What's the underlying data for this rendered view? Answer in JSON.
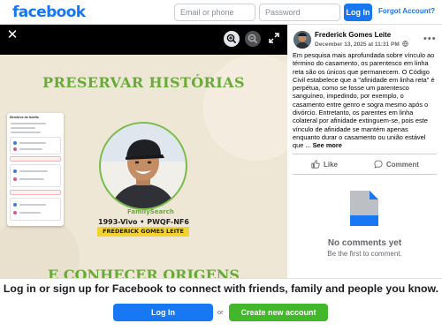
{
  "topbar": {
    "logo": "facebook",
    "email_placeholder": "Email or phone",
    "password_placeholder": "Password",
    "login_label": "Log In",
    "forgot_label": "Forgot Account?"
  },
  "viewer": {
    "close_icon": "close-icon",
    "zoom_in_icon": "zoom-in-icon",
    "zoom_out_icon": "zoom-out-icon",
    "expand_icon": "expand-icon",
    "photo": {
      "title": "PRESERVAR HISTÓRIAS",
      "logo_text": "FamilySearch",
      "person_id": "1993-Vivo • PWQF-NF6",
      "name_banner": "FREDERICK GOMES LEITE",
      "bottom_text": "E CONHECER ORIGENS",
      "card_title": "Membros da família"
    }
  },
  "post": {
    "author": "Frederick Gomes Leite",
    "date": "December 13, 2025 at 11:31 PM",
    "audience_icon": "globe-icon",
    "more_icon": "more-icon",
    "text": "Em pesquisa mais aprofundada sobre vínculo ao término do casamento, os parentesco em linha reta são os únicos que permanecem. O Código Civil estabelece que a \"afinidade em linha reta\" é perpétua, como se fosse um parentesco sanguíneo, impedindo, por exemplo, o casamento entre genro e sogra mesmo após o divórcio. Entretanto, os parentes em linha colateral por afinidade extinguem-se, pois este vínculo de afinidade se mantém apenas enquanto durar o casamento ou união estável que ...",
    "see_more": "See more",
    "like_label": "Like",
    "comment_label": "Comment",
    "no_comments_title": "No comments yet",
    "no_comments_sub": "Be the first to comment."
  },
  "banner": {
    "text": "Log in or sign up for Facebook to connect with friends, family and people you know.",
    "login_label": "Log In",
    "or_label": "or",
    "create_label": "Create new account"
  },
  "colors": {
    "brand_blue": "#1877f2",
    "create_green": "#42b72a",
    "photo_green": "#6aaa3a",
    "name_banner_yellow": "#f2d230"
  }
}
